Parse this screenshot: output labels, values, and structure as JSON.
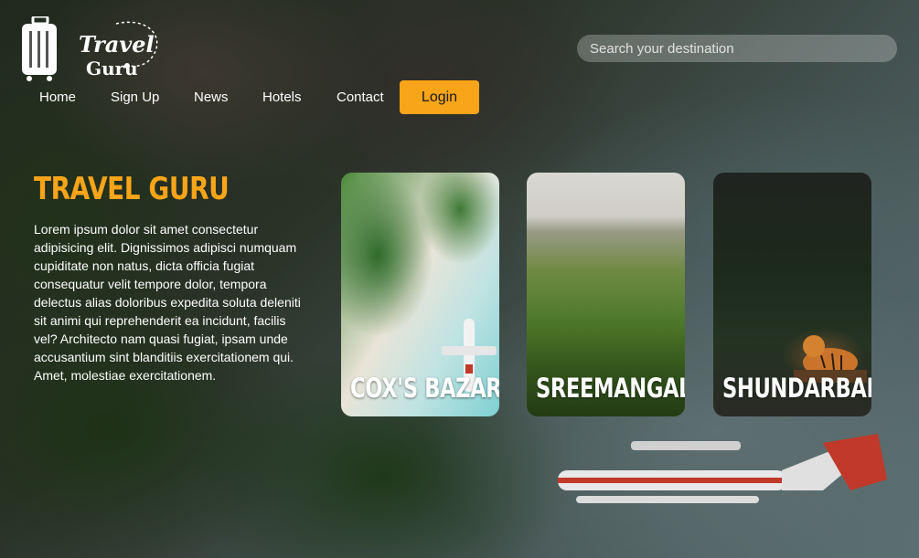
{
  "logo": {
    "line1": "Travel",
    "line2": "Guru",
    "icon": "luggage-icon"
  },
  "search": {
    "placeholder": "Search your destination"
  },
  "nav": {
    "items": [
      {
        "label": "Home"
      },
      {
        "label": "Sign Up"
      },
      {
        "label": "News"
      },
      {
        "label": "Hotels"
      },
      {
        "label": "Contact"
      }
    ],
    "login_label": "Login"
  },
  "hero": {
    "title": "TRAVEL GURU",
    "description": "Lorem ipsum dolor sit amet consectetur adipisicing elit. Dignissimos adipisci numquam cupiditate non natus, dicta officia fugiat consequatur velit tempore dolor, tempora delectus alias doloribus expedita soluta deleniti sit animi qui reprehenderit ea incidunt, facilis vel? Architecto nam quasi fugiat, ipsam unde accusantium sint blanditiis exercitationem qui. Amet, molestiae exercitationem."
  },
  "destinations": [
    {
      "name": "COX'S BAZAR"
    },
    {
      "name": "SREEMANGAL"
    },
    {
      "name": "SHUNDARBAN"
    }
  ],
  "colors": {
    "accent": "#f9a51a",
    "text": "#ffffff"
  }
}
